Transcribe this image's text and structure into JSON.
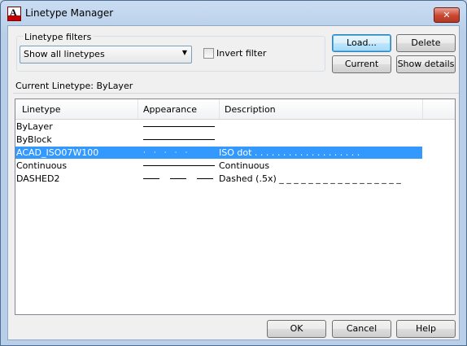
{
  "window": {
    "title": "Linetype Manager",
    "close_label": "✕"
  },
  "filters": {
    "legend": "Linetype filters",
    "selected": "Show all linetypes",
    "invert_label": "Invert filter",
    "invert_checked": false
  },
  "buttons": {
    "load": "Load...",
    "delete": "Delete",
    "current": "Current",
    "show_details": "Show details",
    "ok": "OK",
    "cancel": "Cancel",
    "help": "Help"
  },
  "current_linetype": "Current Linetype:  ByLayer",
  "list": {
    "columns": [
      "Linetype",
      "Appearance",
      "Description"
    ],
    "rows": [
      {
        "linetype": "ByLayer",
        "appearance": "solid",
        "description": "",
        "selected": false
      },
      {
        "linetype": "ByBlock",
        "appearance": "solid",
        "description": "",
        "selected": false
      },
      {
        "linetype": "ACAD_ISO07W100",
        "appearance": "dot",
        "description": "ISO dot . . . . . . . . . . . . . . . . . . .",
        "selected": true
      },
      {
        "linetype": "Continuous",
        "appearance": "solid",
        "description": "Continuous",
        "selected": false
      },
      {
        "linetype": "DASHED2",
        "appearance": "dash",
        "description": "Dashed (.5x) _ _ _ _ _ _ _ _ _ _ _ _ _ _ _ _ _",
        "selected": false
      }
    ]
  },
  "colors": {
    "selection": "#3399ff",
    "close_button": "#c9452f"
  }
}
